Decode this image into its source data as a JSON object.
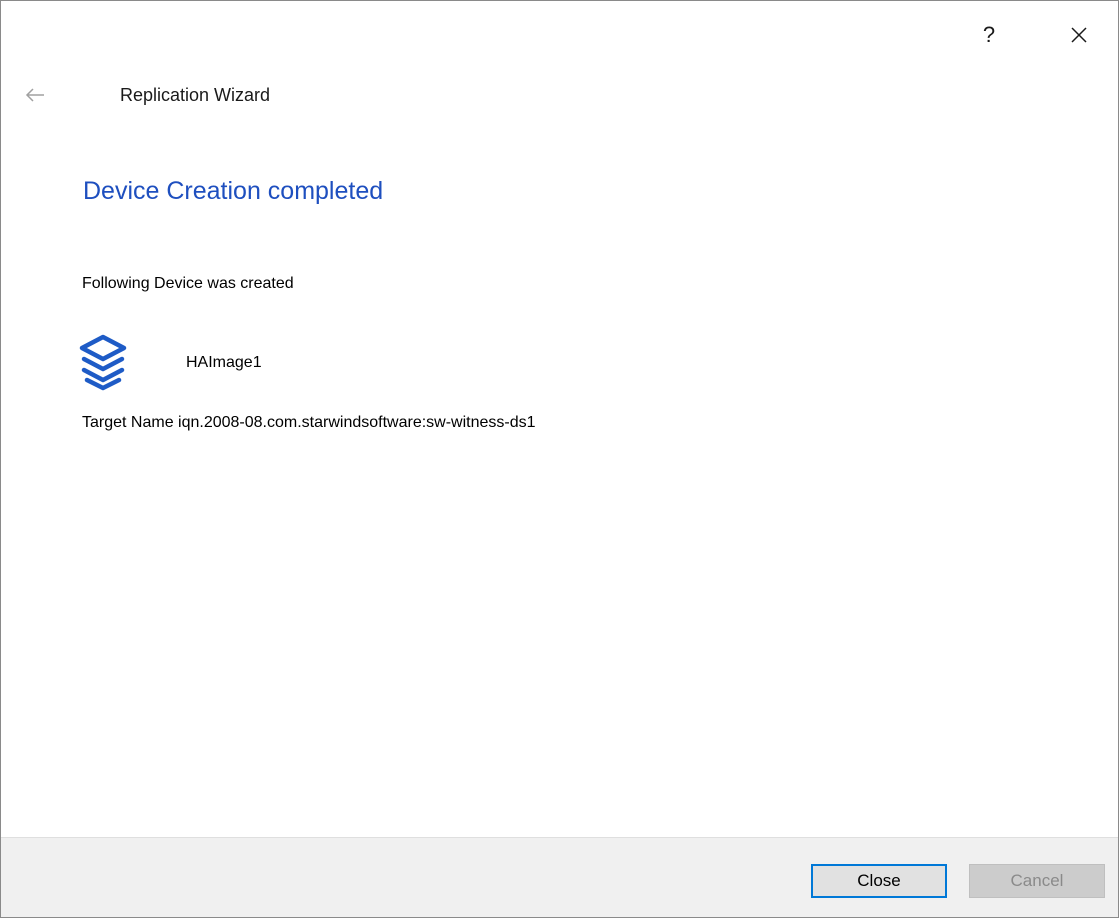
{
  "titlebar": {
    "help_label": "?",
    "close_icon": "close-x-icon"
  },
  "header": {
    "back_icon": "arrow-left-icon",
    "wizard_title": "Replication Wizard"
  },
  "main": {
    "heading": "Device Creation completed",
    "intro": "Following Device was created",
    "device": {
      "icon": "layers-stack-icon",
      "name": "HAImage1"
    },
    "target_line": "Target Name iqn.2008-08.com.starwindsoftware:sw-witness-ds1"
  },
  "footer": {
    "close_label": "Close",
    "cancel_label": "Cancel",
    "cancel_disabled": true
  },
  "colors": {
    "heading": "#1e4fbf",
    "icon": "#1e5bc6",
    "focus_border": "#0078d7",
    "footer_bg": "#f0f0f0"
  }
}
